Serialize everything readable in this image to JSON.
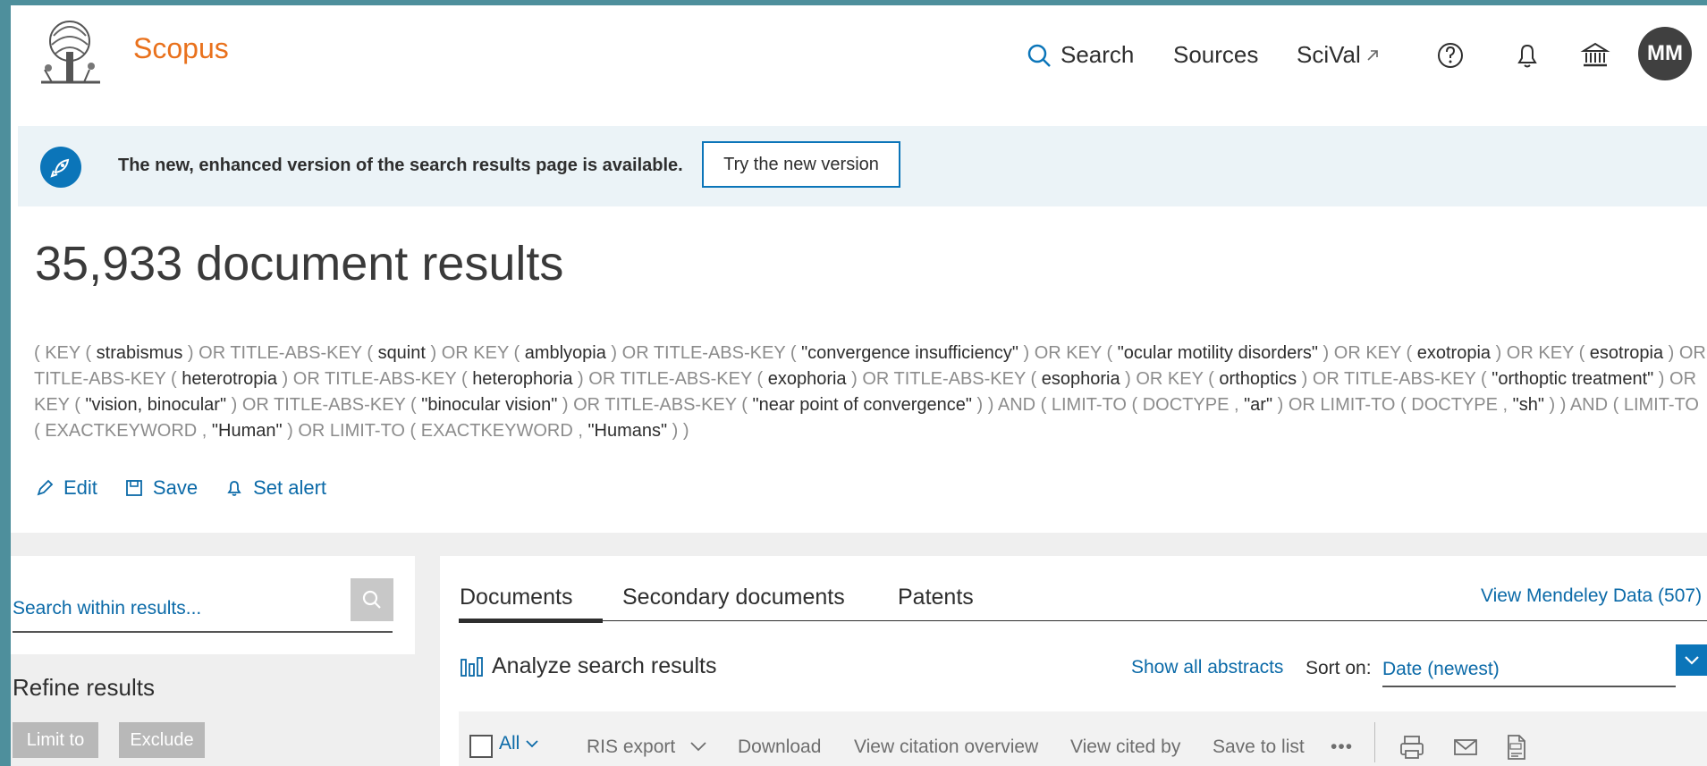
{
  "header": {
    "brand": "Scopus",
    "nav": {
      "search": "Search",
      "sources": "Sources",
      "scival": "SciVal"
    },
    "avatar_initials": "MM",
    "icons": [
      "search-icon",
      "external-link-icon",
      "help-icon",
      "bell-icon",
      "institution-icon"
    ]
  },
  "banner": {
    "text": "The new, enhanced version of the search results page is available.",
    "button": "Try the new version"
  },
  "results": {
    "title": "35,933 document results",
    "query_parts": [
      {
        "t": "( KEY ( ",
        "op": true
      },
      {
        "t": "strabismus"
      },
      {
        "t": " )  OR  TITLE-ABS-KEY ( ",
        "op": true
      },
      {
        "t": "squint"
      },
      {
        "t": " )  OR  KEY ( ",
        "op": true
      },
      {
        "t": "amblyopia"
      },
      {
        "t": " )  OR  TITLE-ABS-KEY ( ",
        "op": true
      },
      {
        "t": "\"convergence insufficiency\""
      },
      {
        "t": " )  OR  KEY ( ",
        "op": true
      },
      {
        "t": "\"ocular motility disorders\""
      },
      {
        "t": " )  OR  KEY ( ",
        "op": true
      },
      {
        "t": "exotropia"
      },
      {
        "t": " )  OR  KEY ( ",
        "op": true
      },
      {
        "t": "esotropia"
      },
      {
        "t": " )  OR  TITLE-ABS-KEY ( ",
        "op": true
      },
      {
        "t": "heterotropia"
      },
      {
        "t": " )  OR  TITLE-ABS-KEY ( ",
        "op": true
      },
      {
        "t": "heterophoria"
      },
      {
        "t": " )  OR  TITLE-ABS-KEY ( ",
        "op": true
      },
      {
        "t": "exophoria"
      },
      {
        "t": " )  OR  TITLE-ABS-KEY ( ",
        "op": true
      },
      {
        "t": "esophoria"
      },
      {
        "t": " )  OR  KEY ( ",
        "op": true
      },
      {
        "t": "orthoptics"
      },
      {
        "t": " )  OR  TITLE-ABS-KEY ( ",
        "op": true
      },
      {
        "t": "\"orthoptic treatment\""
      },
      {
        "t": " )  OR  KEY ( ",
        "op": true
      },
      {
        "t": "\"vision, binocular\""
      },
      {
        "t": " )  OR  TITLE-ABS-KEY ( ",
        "op": true
      },
      {
        "t": "\"binocular vision\""
      },
      {
        "t": " )  OR  TITLE-ABS-KEY ( ",
        "op": true
      },
      {
        "t": "\"near point of convergence\""
      },
      {
        "t": " ) )  AND  ( LIMIT-TO ( DOCTYPE ,  ",
        "op": true
      },
      {
        "t": "\"ar\""
      },
      {
        "t": " )  OR  LIMIT-TO ( DOCTYPE ,  ",
        "op": true
      },
      {
        "t": "\"sh\""
      },
      {
        "t": " ) )  AND  ( LIMIT-TO ( EXACTKEYWORD ,  ",
        "op": true
      },
      {
        "t": "\"Human\""
      },
      {
        "t": " )  OR  LIMIT-TO ( EXACTKEYWORD ,  ",
        "op": true
      },
      {
        "t": "\"Humans\""
      },
      {
        "t": " ) )",
        "op": true
      }
    ],
    "actions": {
      "edit": "Edit",
      "save": "Save",
      "set_alert": "Set alert"
    }
  },
  "sidebar": {
    "search_placeholder": "Search within results...",
    "refine_title": "Refine results",
    "limit_to": "Limit to",
    "exclude": "Exclude"
  },
  "main": {
    "tabs": [
      "Documents",
      "Secondary documents",
      "Patents"
    ],
    "active_tab": "Documents",
    "mendeley": "View Mendeley Data (507)",
    "analyze": "Analyze search results",
    "show_abstracts": "Show all abstracts",
    "sort_label": "Sort on:",
    "sort_value": "Date (newest)"
  },
  "toolbar": {
    "all": "All",
    "ris_export": "RIS export",
    "download": "Download",
    "view_citation": "View citation overview",
    "view_cited_by": "View cited by",
    "save_to_list": "Save to list",
    "more": "•••"
  },
  "colors": {
    "brand_orange": "#e9711c",
    "link_blue": "#0b6aa8",
    "accent_blue": "#0b75b9"
  }
}
